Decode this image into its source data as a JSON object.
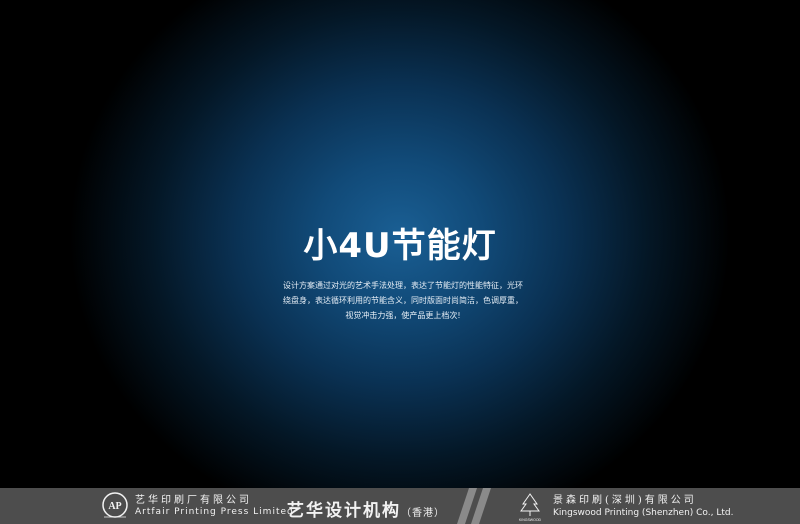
{
  "slide": {
    "title": "小4U节能灯",
    "description": "设计方案通过对光的艺术手法处理，表达了节能灯的性能特征，光环绕盘身，表达循环利用的节能含义，同时版面时尚简洁，色调厚重，视觉冲击力强，使产品更上档次!"
  },
  "footer": {
    "left_company_cn": "艺华印刷厂有限公司",
    "left_company_en": "Artfair Printing Press Limited",
    "brand": "艺华设计机构",
    "brand_sub": "（香港）",
    "right_company_cn": "景森印刷(深圳)有限公司",
    "right_company_en": "Kingswood Printing (Shenzhen) Co., Ltd.",
    "left_logo_text": "AP",
    "right_logo_text": "KINGSWOOD"
  },
  "colors": {
    "background_center": "#1a5f94",
    "background_edge": "#000000",
    "footer_bar": "#4d4d4d",
    "text": "#ffffff"
  }
}
